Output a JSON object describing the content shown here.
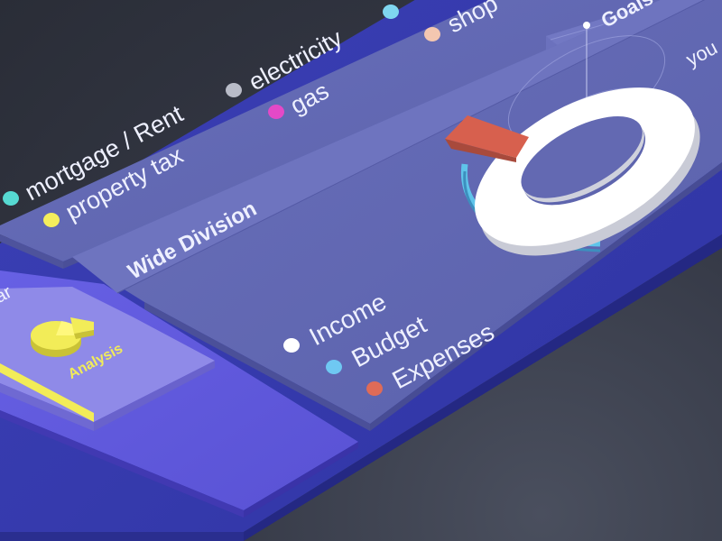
{
  "legend_top": {
    "items": [
      {
        "label": "mortgage / Rent",
        "color": "#56d9d2"
      },
      {
        "label": "property tax",
        "color": "#f5ee5c"
      },
      {
        "label": "electricity",
        "color": "#b9bcc8"
      },
      {
        "label": "gas",
        "color": "#e449c7"
      },
      {
        "label": "shop",
        "color": "#f4c7b0"
      },
      {
        "label": "",
        "color": "#7fd6f0"
      }
    ]
  },
  "wide_division": {
    "title": "Wide Division",
    "legend": [
      {
        "label": "Income",
        "color": "#ffffff"
      },
      {
        "label": "Budget",
        "color": "#6fc8f2"
      },
      {
        "label": "Expenses",
        "color": "#df6b57"
      }
    ]
  },
  "goals": {
    "title": "Goals",
    "input_partial": "you"
  },
  "nav": {
    "analysis_label": "Analysis",
    "left_partial": "ar"
  },
  "colors": {
    "card": "#5c63ad",
    "card_light": "#6c73bd",
    "accent_yellow": "#f2ec58",
    "donut_red": "#d7604e",
    "donut_blue": "#5fc4ea"
  },
  "icons": {
    "analysis": "pie-chart-icon",
    "donut": "donut-chart-icon"
  }
}
